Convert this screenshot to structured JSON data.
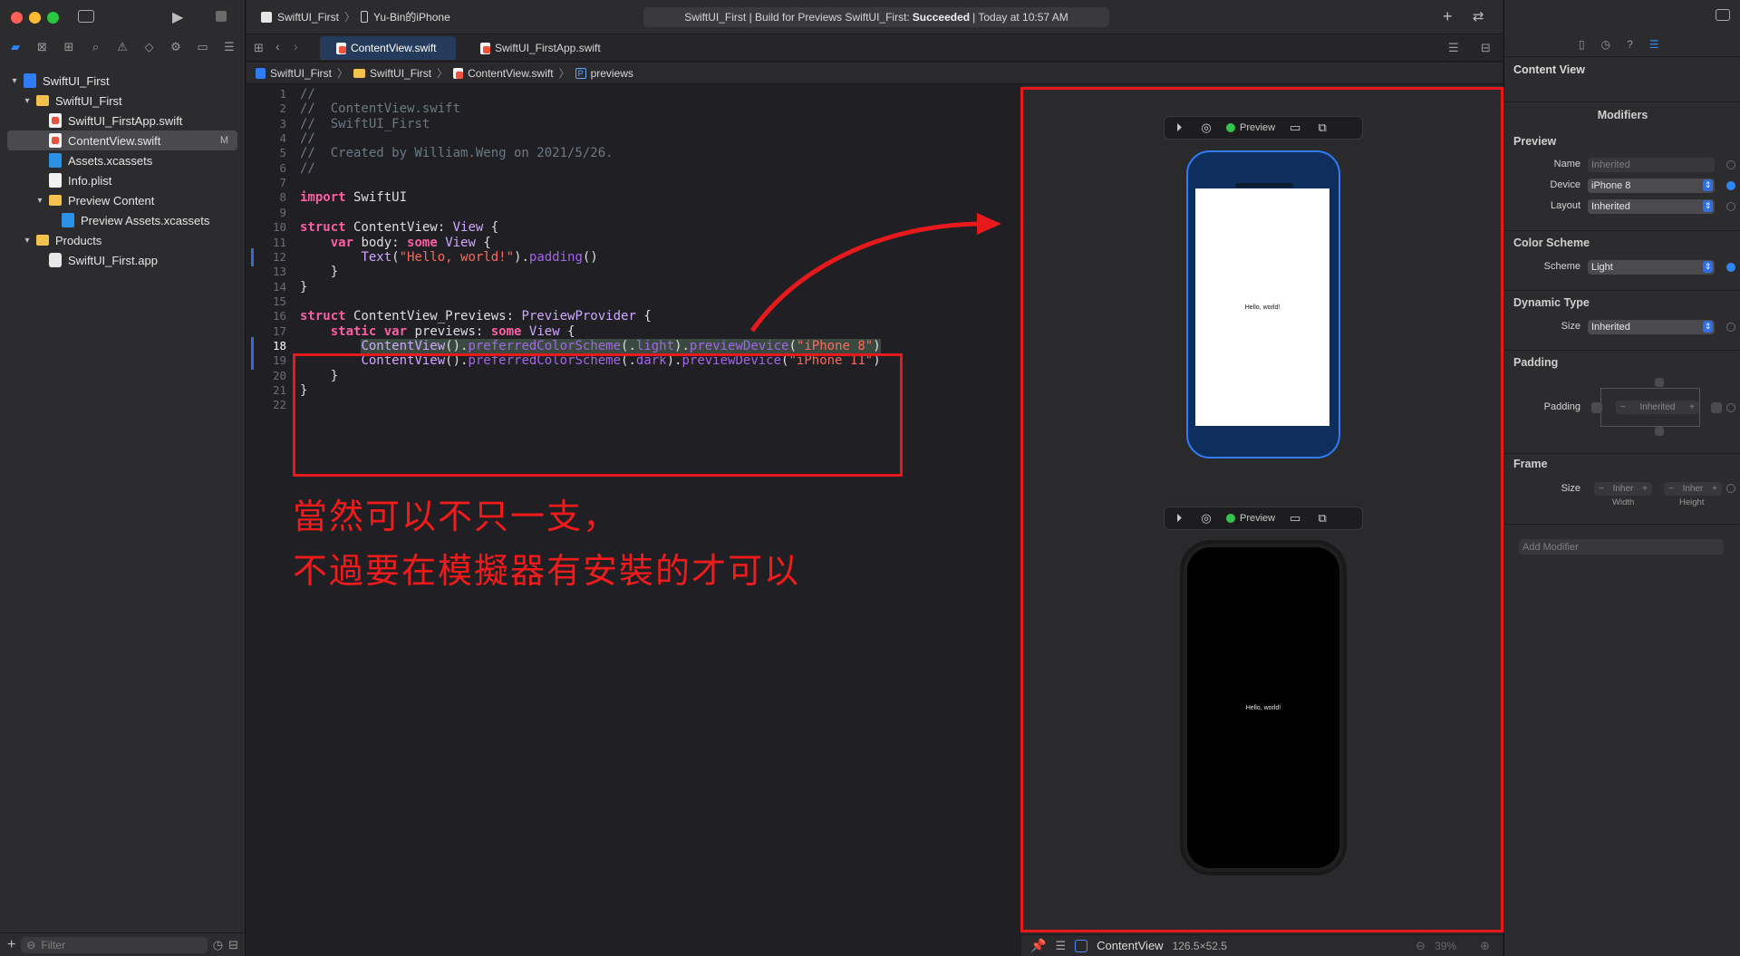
{
  "toolbar": {
    "scheme_target": "SwiftUI_First",
    "scheme_device": "Yu-Bin的iPhone",
    "status_prefix": "SwiftUI_First | Build for Previews SwiftUI_First:",
    "status_result": "Succeeded",
    "status_time": "| Today at 10:57 AM"
  },
  "sidebar": {
    "items": [
      {
        "label": "SwiftUI_First",
        "kind": "proj",
        "indent": 0,
        "chevron": "▾"
      },
      {
        "label": "SwiftUI_First",
        "kind": "folder",
        "indent": 1,
        "chevron": "▾"
      },
      {
        "label": "SwiftUI_FirstApp.swift",
        "kind": "swift",
        "indent": 2,
        "chevron": ""
      },
      {
        "label": "ContentView.swift",
        "kind": "swift",
        "indent": 2,
        "chevron": "",
        "badge": "M",
        "selected": true
      },
      {
        "label": "Assets.xcassets",
        "kind": "assets",
        "indent": 2,
        "chevron": ""
      },
      {
        "label": "Info.plist",
        "kind": "plist",
        "indent": 2,
        "chevron": ""
      },
      {
        "label": "Preview Content",
        "kind": "folder",
        "indent": 2,
        "chevron": "▾"
      },
      {
        "label": "Preview Assets.xcassets",
        "kind": "assets",
        "indent": 3,
        "chevron": ""
      },
      {
        "label": "Products",
        "kind": "folder",
        "indent": 1,
        "chevron": "▾"
      },
      {
        "label": "SwiftUI_First.app",
        "kind": "app",
        "indent": 2,
        "chevron": ""
      }
    ],
    "filter_placeholder": "Filter"
  },
  "tabs": [
    {
      "label": "ContentView.swift",
      "active": true
    },
    {
      "label": "SwiftUI_FirstApp.swift",
      "active": false
    }
  ],
  "breadcrumb": [
    "SwiftUI_First",
    "SwiftUI_First",
    "ContentView.swift",
    "previews"
  ],
  "editor": {
    "current_line": 18,
    "lines": [
      [
        [
          "c-cm",
          "//"
        ]
      ],
      [
        [
          "c-cm",
          "//  ContentView.swift"
        ]
      ],
      [
        [
          "c-cm",
          "//  SwiftUI_First"
        ]
      ],
      [
        [
          "c-cm",
          "//"
        ]
      ],
      [
        [
          "c-cm",
          "//  Created by William.Weng on 2021/5/26."
        ]
      ],
      [
        [
          "c-cm",
          "//"
        ]
      ],
      [],
      [
        [
          "c-kw",
          "import"
        ],
        [
          "c-pl",
          " SwiftUI"
        ]
      ],
      [],
      [
        [
          "c-kw",
          "struct"
        ],
        [
          "c-pl",
          " ContentView: "
        ],
        [
          "c-ty",
          "View"
        ],
        [
          "c-pl",
          " {"
        ]
      ],
      [
        [
          "c-pl",
          "    "
        ],
        [
          "c-kw",
          "var"
        ],
        [
          "c-pl",
          " body: "
        ],
        [
          "c-kw",
          "some"
        ],
        [
          "c-pl",
          " "
        ],
        [
          "c-ty",
          "View"
        ],
        [
          "c-pl",
          " {"
        ]
      ],
      [
        [
          "c-pl",
          "        "
        ],
        [
          "c-ty",
          "Text"
        ],
        [
          "c-pl",
          "("
        ],
        [
          "c-st",
          "\"Hello, world!\""
        ],
        [
          "c-pl",
          ")."
        ],
        [
          "c-fn",
          "padding"
        ],
        [
          "c-pl",
          "()"
        ]
      ],
      [
        [
          "c-pl",
          "    }"
        ]
      ],
      [
        [
          "c-pl",
          "}"
        ]
      ],
      [],
      [
        [
          "c-kw",
          "struct"
        ],
        [
          "c-pl",
          " ContentView_Previews: "
        ],
        [
          "c-ty",
          "PreviewProvider"
        ],
        [
          "c-pl",
          " {"
        ]
      ],
      [
        [
          "c-pl",
          "    "
        ],
        [
          "c-kw",
          "static"
        ],
        [
          "c-pl",
          " "
        ],
        [
          "c-kw",
          "var"
        ],
        [
          "c-pl",
          " previews: "
        ],
        [
          "c-kw",
          "some"
        ],
        [
          "c-pl",
          " "
        ],
        [
          "c-ty",
          "View"
        ],
        [
          "c-pl",
          " {"
        ]
      ],
      [
        [
          "c-pl",
          "        "
        ],
        [
          "c-ty hl",
          "ContentView"
        ],
        [
          "c-pl hl",
          "()."
        ],
        [
          "c-fn hl",
          "preferredColorScheme"
        ],
        [
          "c-pl hl",
          "(."
        ],
        [
          "c-fn hl",
          "light"
        ],
        [
          "c-pl hl",
          ")."
        ],
        [
          "c-fn hl",
          "previewDevice"
        ],
        [
          "c-pl hl",
          "("
        ],
        [
          "c-st hl",
          "\"iPhone 8\""
        ],
        [
          "c-pl hl",
          ")"
        ]
      ],
      [
        [
          "c-pl",
          "        "
        ],
        [
          "c-ty",
          "ContentView"
        ],
        [
          "c-pl",
          "()."
        ],
        [
          "c-fn",
          "preferredColorScheme"
        ],
        [
          "c-pl",
          "(."
        ],
        [
          "c-fn",
          "dark"
        ],
        [
          "c-pl",
          ")."
        ],
        [
          "c-fn",
          "previewDevice"
        ],
        [
          "c-pl",
          "("
        ],
        [
          "c-st",
          "\"iPhone 11\""
        ],
        [
          "c-pl",
          ")"
        ]
      ],
      [
        [
          "c-pl",
          "    }"
        ]
      ],
      [
        [
          "c-pl",
          "}"
        ]
      ],
      []
    ]
  },
  "annotation": {
    "line1": "當然可以不只一支，",
    "line2": "不過要在模擬器有安裝的才可以",
    "color": "#e8191c"
  },
  "canvas": {
    "preview_label_1": "Preview",
    "preview_label_2": "Preview",
    "screen_text_light": "Hello, world!",
    "screen_text_dark": "Hello, world!",
    "footer_view": "ContentView",
    "footer_size": "126.5×52.5",
    "zoom": "39%"
  },
  "inspector": {
    "title": "Content View",
    "modifiers_heading": "Modifiers",
    "preview_heading": "Preview",
    "name_label": "Name",
    "name_placeholder": "Inherited",
    "device_label": "Device",
    "device_value": "iPhone 8",
    "layout_label": "Layout",
    "layout_value": "Inherited",
    "color_scheme_heading": "Color Scheme",
    "scheme_label": "Scheme",
    "scheme_value": "Light",
    "dynamic_type_heading": "Dynamic Type",
    "size_label": "Size",
    "size_value": "Inherited",
    "padding_heading": "Padding",
    "padding_label": "Padding",
    "padding_value": "Inherited",
    "frame_heading": "Frame",
    "frame_size_label": "Size",
    "width_placeholder": "Inher",
    "height_placeholder": "Inher",
    "width_caption": "Width",
    "height_caption": "Height",
    "add_modifier_placeholder": "Add Modifier"
  },
  "colors": {
    "accent": "#2f87f7",
    "annotation_red": "#e8191c",
    "preview_green": "#31c54e"
  }
}
